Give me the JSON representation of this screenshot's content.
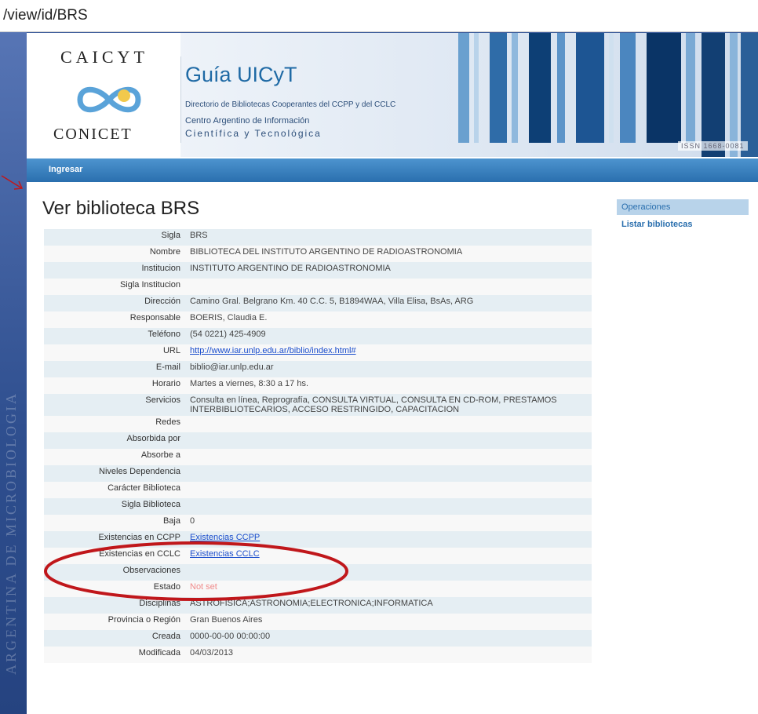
{
  "browser": {
    "url_fragment": "/view/id/BRS"
  },
  "header": {
    "logo_top": "CAICYT",
    "logo_bottom": "CONICET",
    "title": "Guía UICyT",
    "subtitle": "Directorio de Bibliotecas Cooperantes del CCPP y del CCLC",
    "centro_line1": "Centro Argentino de Información",
    "centro_line2": "Científica y Tecnológica",
    "issn": "ISSN 1668-0081"
  },
  "nav": {
    "ingresar": "Ingresar"
  },
  "page": {
    "heading": "Ver biblioteca BRS"
  },
  "sidebar": {
    "title": "Operaciones",
    "items": [
      {
        "label": "Listar bibliotecas"
      }
    ]
  },
  "detail": {
    "rows": [
      {
        "label": "Sigla",
        "value": "BRS"
      },
      {
        "label": "Nombre",
        "value": "BIBLIOTECA DEL INSTITUTO ARGENTINO DE RADIOASTRONOMIA"
      },
      {
        "label": "Institucion",
        "value": "INSTITUTO ARGENTINO DE RADIOASTRONOMIA"
      },
      {
        "label": "Sigla Institucion",
        "value": ""
      },
      {
        "label": "Dirección",
        "value": "Camino Gral. Belgrano Km. 40 C.C. 5, B1894WAA, Villa Elisa, BsAs, ARG"
      },
      {
        "label": "Responsable",
        "value": "BOERIS, Claudia E."
      },
      {
        "label": "Teléfono",
        "value": "(54 0221) 425-4909"
      },
      {
        "label": "URL",
        "value": "http://www.iar.unlp.edu.ar/biblio/index.html#"
      },
      {
        "label": "E-mail",
        "value": "biblio@iar.unlp.edu.ar"
      },
      {
        "label": "Horario",
        "value": "Martes a viernes, 8:30 a 17 hs."
      },
      {
        "label": "Servicios",
        "value": "Consulta en línea, Reprografía, CONSULTA VIRTUAL, CONSULTA EN CD-ROM, PRESTAMOS INTERBIBLIOTECARIOS, ACCESO RESTRINGIDO, CAPACITACION"
      },
      {
        "label": "Redes",
        "value": ""
      },
      {
        "label": "Absorbida por",
        "value": ""
      },
      {
        "label": "Absorbe a",
        "value": ""
      },
      {
        "label": "Niveles Dependencia",
        "value": ""
      },
      {
        "label": "Carácter Biblioteca",
        "value": ""
      },
      {
        "label": "Sigla Biblioteca",
        "value": ""
      },
      {
        "label": "Baja",
        "value": "0"
      },
      {
        "label": "Existencias en CCPP",
        "value": "Existencias CCPP"
      },
      {
        "label": "Existencias en CCLC",
        "value": "Existencias CCLC"
      },
      {
        "label": "Observaciones",
        "value": ""
      },
      {
        "label": "Estado",
        "value": "Not set"
      },
      {
        "label": "Disciplinas",
        "value": "ASTROFISICA;ASTRONOMIA;ELECTRONICA;INFORMATICA"
      },
      {
        "label": "Provincia o Región",
        "value": "Gran Buenos Aires"
      },
      {
        "label": "Creada",
        "value": "0000-00-00 00:00:00"
      },
      {
        "label": "Modificada",
        "value": "04/03/2013"
      }
    ]
  },
  "colors": {
    "nav_blue": "#2a6fae",
    "annotation_red": "#c0171b",
    "row_alt": "#e5eef3"
  }
}
